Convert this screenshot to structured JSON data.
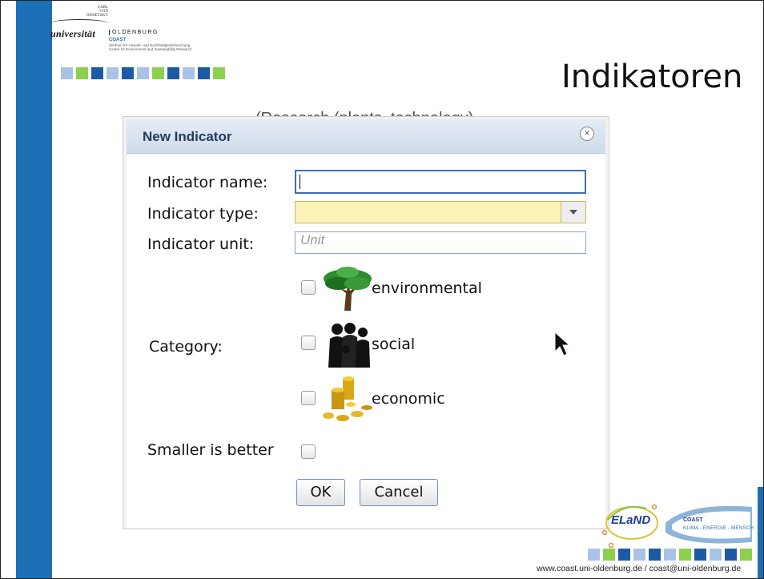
{
  "slide": {
    "title": "Indikatoren",
    "footer": "www.coast.uni-oldenburg.de / coast@uni-oldenburg.de",
    "colors": {
      "sidebar": "#1a6fb5",
      "square_dark": "#1d5aa6",
      "square_light": "#a9c3e6",
      "square_green": "#8dd04d"
    }
  },
  "logo": {
    "small_lines": [
      "CARL",
      "VON",
      "OSSIETZKY"
    ],
    "main": "universität",
    "city": "OLDENBURG",
    "coast": "COAST",
    "coast_sub1": "Zentrum für Umwelt- und Nachhaltigkeitsforschung",
    "coast_sub2": "Centre for Environment and Sustainability Research"
  },
  "background_text": "(Research (plants, technology)",
  "dialog": {
    "title": "New Indicator",
    "close_icon": "close-icon",
    "name_label": "Indicator name:",
    "name_value": "",
    "type_label": "Indicator type:",
    "type_value": "",
    "unit_label": "Indicator unit:",
    "unit_placeholder": "Unit",
    "category_label": "Category:",
    "categories": [
      {
        "label": "environmental",
        "icon": "tree-icon",
        "checked": false
      },
      {
        "label": "social",
        "icon": "people-icon",
        "checked": false
      },
      {
        "label": "economic",
        "icon": "coins-icon",
        "checked": false
      }
    ],
    "smaller_label": "Smaller is better",
    "smaller_checked": false,
    "ok_label": "OK",
    "cancel_label": "Cancel"
  },
  "partners": {
    "eland": "ELaND",
    "coast_badge": "COAST",
    "coast_tagline": "KLIMA - ENERGIE - MENSCH"
  }
}
